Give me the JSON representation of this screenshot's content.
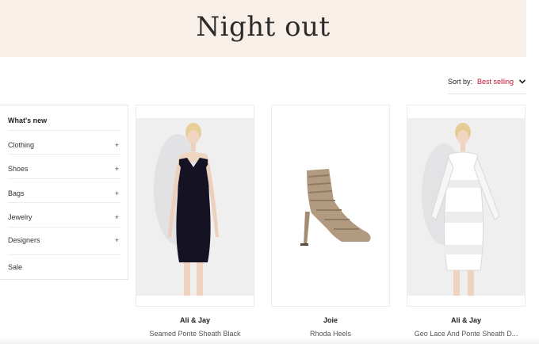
{
  "page": {
    "title": "Night out"
  },
  "sort": {
    "label": "Sort by:",
    "value": "Best selling"
  },
  "sidebar": {
    "items": [
      {
        "label": "What's new",
        "has_expand": false
      },
      {
        "label": "Clothing",
        "has_expand": true
      },
      {
        "label": "Shoes",
        "has_expand": true
      },
      {
        "label": "Bags",
        "has_expand": true
      },
      {
        "label": "Jewelry",
        "has_expand": true
      },
      {
        "label": "Designers",
        "has_expand": true
      },
      {
        "label": "Sale",
        "has_expand": false
      }
    ],
    "expand_symbol": "+"
  },
  "products": [
    {
      "brand": "Ali & Jay",
      "name": "Seamed Ponte Sheath Black",
      "image": "black-dress-photo"
    },
    {
      "brand": "Joie",
      "name": "Rhoda Heels",
      "image": "heels-photo"
    },
    {
      "brand": "Ali & Jay",
      "name": "Geo Lace And Ponte Sheath D...",
      "image": "white-lace-dress-photo"
    }
  ],
  "colors": {
    "accent": "#c0152f",
    "hero_bg": "#f8efe9"
  }
}
